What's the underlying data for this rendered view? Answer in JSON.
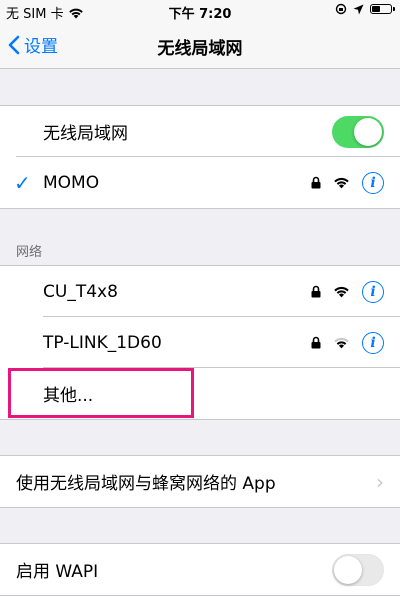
{
  "status_bar": {
    "carrier": "无 SIM 卡",
    "time": "下午 7:20"
  },
  "nav": {
    "back_label": "设置",
    "title": "无线局域网"
  },
  "wifi_toggle": {
    "label": "无线局域网",
    "on": true
  },
  "connected_network": {
    "name": "MOMO"
  },
  "networks_header": "网络",
  "networks": [
    {
      "name": "CU_T4x8"
    },
    {
      "name": "TP-LINK_1D60"
    }
  ],
  "other_label": "其他...",
  "apps_row": {
    "label": "使用无线局域网与蜂窝网络的 App"
  },
  "wapi_toggle": {
    "label": "启用 WAPI",
    "on": false
  },
  "colors": {
    "accent": "#007aff",
    "toggle_on": "#4cd964",
    "highlight": "#e5177f"
  }
}
